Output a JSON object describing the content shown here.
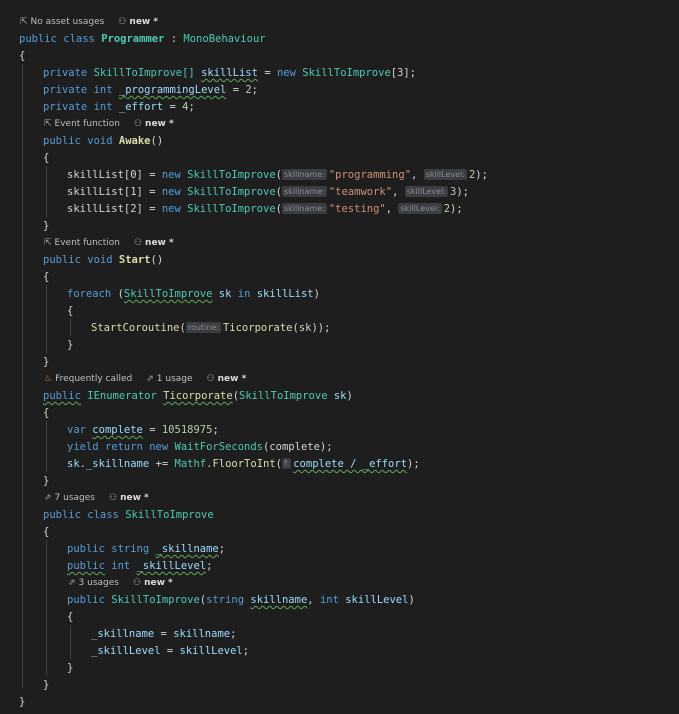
{
  "lens": {
    "class_programmer": {
      "usages": "No asset usages",
      "author": "new *"
    },
    "awake": {
      "kind": "Event function",
      "author": "new *"
    },
    "start": {
      "kind": "Event function",
      "author": "new *"
    },
    "ticorporate": {
      "freq": "Frequently called",
      "usages": "1 usage",
      "author": "new *"
    },
    "class_skill": {
      "usages": "7 usages",
      "author": "new *"
    },
    "ctor": {
      "usages": "3 usages",
      "author": "new *"
    }
  },
  "code": {
    "l1": {
      "kw1": "public",
      "kw2": "class",
      "name": "Programmer",
      "sep": ":",
      "base": "MonoBehaviour"
    },
    "brace_open": "{",
    "brace_close": "}",
    "l3": {
      "kw": "private",
      "type": "SkillToImprove[]",
      "var": "skillList",
      "eq": "=",
      "new": "new",
      "type2": "SkillToImprove",
      "idx": "[3];"
    },
    "l4": {
      "kw": "private",
      "type": "int",
      "var": "_programmingLevel",
      "eq": "=",
      "val": "2",
      "semi": ";"
    },
    "l5": {
      "kw": "private",
      "type": "int",
      "var": "_effort",
      "eq": "=",
      "val": "4",
      "semi": ";"
    },
    "awake": {
      "kw": "public",
      "kw2": "void",
      "name": "Awake",
      "parens": "()"
    },
    "sl0": {
      "lhs": "skillList[0]",
      "eq": "=",
      "new": "new",
      "type": "SkillToImprove",
      "open": "(",
      "hint1": "skillname:",
      "arg1": "\"programming\"",
      "comma": ",",
      "hint2": "skillLevel:",
      "arg2": "2",
      "close": ");"
    },
    "sl1": {
      "lhs": "skillList[1]",
      "eq": "=",
      "new": "new",
      "type": "SkillToImprove",
      "open": "(",
      "hint1": "skillname:",
      "arg1": "\"teamwork\"",
      "comma": ",",
      "hint2": "skillLevel:",
      "arg2": "3",
      "close": ");"
    },
    "sl2": {
      "lhs": "skillList[2]",
      "eq": "=",
      "new": "new",
      "type": "SkillToImprove",
      "open": "(",
      "hint1": "skillname:",
      "arg1": "\"testing\"",
      "comma": ",",
      "hint2": "skillLevel:",
      "arg2": "2",
      "close": ");"
    },
    "start": {
      "kw": "public",
      "kw2": "void",
      "name": "Start",
      "parens": "()"
    },
    "foreach": {
      "kw": "foreach",
      "open": "(",
      "type": "SkillToImprove",
      "var": "sk",
      "in": "in",
      "coll": "skillList",
      "close": ")"
    },
    "coroutine": {
      "fn": "StartCoroutine",
      "open": "(",
      "hint": "routine:",
      "fn2": "Ticorporate",
      "args": "(sk));"
    },
    "ticorp": {
      "kw": "public",
      "type": "IEnumerator",
      "name": "Ticorporate",
      "open": "(",
      "ptype": "SkillToImprove",
      "pvar": "sk",
      "close": ")"
    },
    "complete": {
      "kw": "var",
      "var": "complete",
      "eq": "=",
      "val": "10518975",
      "semi": ";"
    },
    "yield": {
      "kw1": "yield",
      "kw2": "return",
      "kw3": "new",
      "type": "WaitForSeconds",
      "args": "(complete);"
    },
    "skname": {
      "obj": "sk",
      "dot": ".",
      "field": "_skillname",
      "op": "+=",
      "type": "Mathf",
      "dot2": ".",
      "fn": "FloorToInt",
      "open": "(",
      "hint": "f:",
      "expr": "complete / _effort",
      "close": ");"
    },
    "skclass": {
      "kw1": "public",
      "kw2": "class",
      "name": "SkillToImprove"
    },
    "f1": {
      "kw": "public",
      "type": "string",
      "var": "_skillname",
      "semi": ";"
    },
    "f2": {
      "kw": "public",
      "type": "int",
      "var": "_skillLevel",
      "semi": ";"
    },
    "ctor": {
      "kw": "public",
      "name": "SkillToImprove",
      "open": "(",
      "t1": "string",
      "p1": "skillname",
      "comma": ",",
      "t2": "int",
      "p2": "skillLevel",
      "close": ")"
    },
    "a1": {
      "lhs": "_skillname",
      "eq": "=",
      "rhs": "skillname",
      "semi": ";"
    },
    "a2": {
      "lhs": "_skillLevel",
      "eq": "=",
      "rhs": "skillLevel",
      "semi": ";"
    }
  }
}
